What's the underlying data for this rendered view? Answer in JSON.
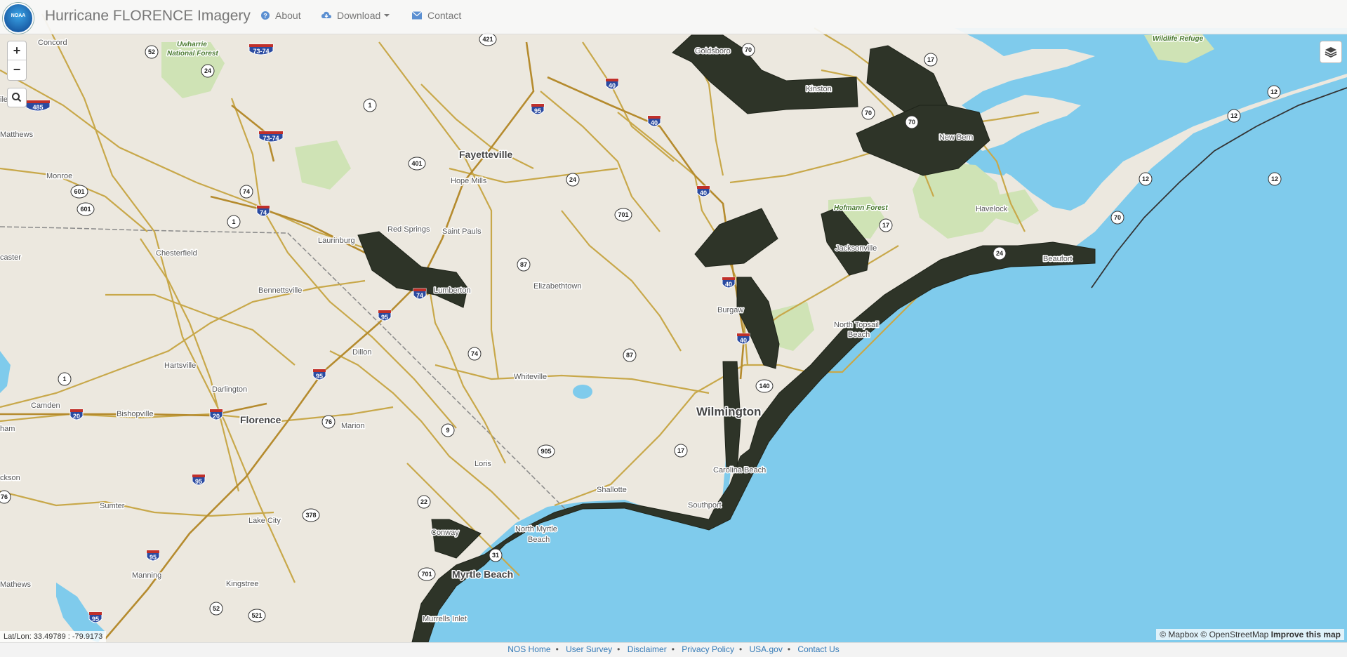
{
  "navbar": {
    "title": "Hurricane FLORENCE Imagery",
    "logo_text": "NOAA",
    "items": [
      {
        "label": "About",
        "icon": "question-circle-icon"
      },
      {
        "label": "Download",
        "icon": "cloud-download-icon"
      },
      {
        "label": "Contact",
        "icon": "envelope-icon"
      }
    ]
  },
  "controls": {
    "zoom_in": "+",
    "zoom_out": "−",
    "search_icon": "search-icon",
    "layers_icon": "layers-icon"
  },
  "status": {
    "coords": "Lat/Lon: 33.49789 : -79.9173"
  },
  "attribution": {
    "mapbox": "© Mapbox",
    "osm": "© OpenStreetMap",
    "improve": "Improve this map"
  },
  "footer": {
    "links": [
      "NOS Home",
      "User Survey",
      "Disclaimer",
      "Privacy Policy",
      "USA.gov",
      "Contact Us"
    ]
  },
  "map": {
    "colors": {
      "land": "#ece8df",
      "water": "#7fcbec",
      "road": "#c8a84a",
      "imagery": "#2e3428",
      "park": "#cfe3b5"
    },
    "places": [
      "Concord",
      "Matthews",
      "Monroe",
      "Chesterfield",
      "Bennettsville",
      "Hartsville",
      "Darlington",
      "Florence",
      "Camden",
      "Bishopville",
      "Sumter",
      "Manning",
      "Kingstree",
      "Lake City",
      "Marion",
      "Dillon",
      "Laurinburg",
      "Red Springs",
      "Saint Pauls",
      "Lumberton",
      "Hope Mills",
      "Fayetteville",
      "Elizabethtown",
      "Whiteville",
      "Loris",
      "Conway",
      "Myrtle Beach",
      "North Myrtle Beach",
      "Murrells Inlet",
      "Shallotte",
      "Southport",
      "Carolina Beach",
      "Wilmington",
      "Burgaw",
      "Jacksonville",
      "North Topsail Beach",
      "Kinston",
      "Goldsboro",
      "New Bern",
      "Havelock",
      "Beaufort",
      "Uwharrie National Forest",
      "Hofmann Forest",
      "Wildlife Refuge",
      "Mathews",
      "Lancaster"
    ],
    "labels": {
      "concord": "Concord",
      "uwharrie": "Uwharrie\nNational Forest",
      "matthews": "Matthews",
      "monroe": "Monroe",
      "chesterfield": "Chesterfield",
      "bennettsville": "Bennettsville",
      "hartsville": "Hartsville",
      "darlington": "Darlington",
      "florence": "Florence",
      "camden": "Camden",
      "bishopville": "Bishopville",
      "sumter": "Sumter",
      "manning": "Manning",
      "kingstree": "Kingstree",
      "lakecity": "Lake City",
      "marion": "Marion",
      "dillon": "Dillon",
      "laurinburg": "Laurinburg",
      "redsprings": "Red Springs",
      "saintpauls": "Saint Pauls",
      "lumberton": "Lumberton",
      "hopemills": "Hope Mills",
      "fayetteville": "Fayetteville",
      "elizabethtown": "Elizabethtown",
      "whiteville": "Whiteville",
      "loris": "Loris",
      "conway": "Conway",
      "myrtlebeach": "Myrtle Beach",
      "northmyrtle1": "North Myrtle",
      "northmyrtle2": "Beach",
      "murrells": "Murrells Inlet",
      "shallotte": "Shallotte",
      "southport": "Southport",
      "carolinabeach": "Carolina Beach",
      "wilmington": "Wilmington",
      "burgaw": "Burgaw",
      "jacksonville": "Jacksonville",
      "topsail1": "North Topsail",
      "topsail2": "Beach",
      "kinston": "Kinston",
      "goldsboro": "Goldsboro",
      "newbern": "New Bern",
      "havelock": "Havelock",
      "beaufort": "Beaufort",
      "hofmann": "Hofmann Forest",
      "wildlife": "Wildlife Refuge",
      "lancaster": "caster",
      "jackson": "ckson",
      "ham": "ham",
      "ile": "ile",
      "mathews2": "Mathews"
    },
    "shields": [
      "52",
      "24",
      "421",
      "70",
      "17",
      "1",
      "401",
      "24",
      "74",
      "1",
      "601",
      "601",
      "87",
      "701",
      "70",
      "70",
      "12",
      "12",
      "12",
      "12",
      "70",
      "24",
      "17",
      "74",
      "87",
      "140",
      "17",
      "905",
      "9",
      "1",
      "76",
      "378",
      "22",
      "701",
      "31",
      "52",
      "521",
      "76"
    ],
    "interstates": [
      "73-74",
      "485",
      "73-74",
      "74",
      "95",
      "40",
      "40",
      "40",
      "40",
      "95",
      "74",
      "95",
      "20",
      "20",
      "95",
      "95",
      "95",
      "40"
    ]
  }
}
